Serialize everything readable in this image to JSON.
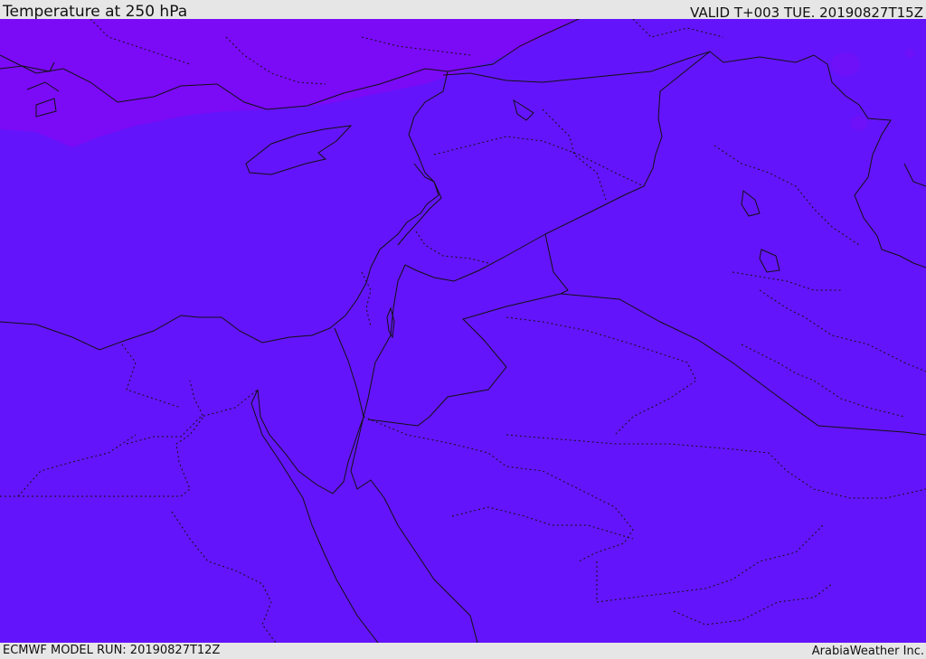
{
  "header": {
    "title": "Temperature at 250 hPa",
    "valid_time": "VALID T+003 TUE. 20190827T15Z"
  },
  "footer": {
    "model_run": "ECMWF MODEL RUN: 20190827T12Z",
    "credit": "ArabiaWeather Inc."
  },
  "map": {
    "field_colors": {
      "main": "#6414fa",
      "cold_band": "#7b0af7",
      "patch": "#6e10f8"
    },
    "line_color": "#111111"
  }
}
